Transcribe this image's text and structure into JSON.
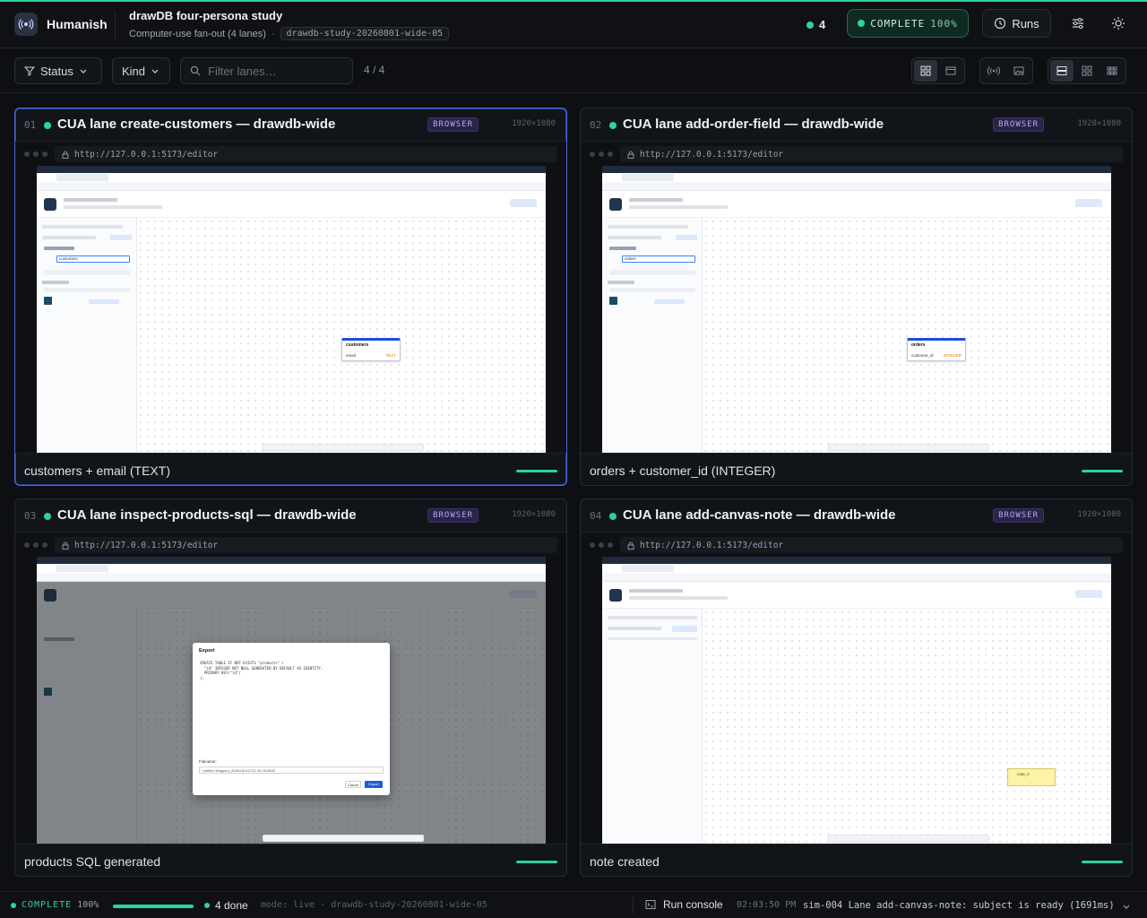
{
  "brand": {
    "name": "Humanish"
  },
  "header": {
    "title": "drawDB four-persona study",
    "subtitle": "Computer-use fan-out (4 lanes)",
    "separator": "·",
    "study_id": "drawdb-study-20260801-wide-05",
    "live_count": "4",
    "status_label": "COMPLETE",
    "status_pct": "100%",
    "runs_label": "Runs"
  },
  "toolbar": {
    "status_label": "Status",
    "kind_label": "Kind",
    "search_placeholder": "Filter lanes…",
    "count": "4 / 4"
  },
  "lanes": [
    {
      "num": "01",
      "title": "CUA lane create-customers — drawdb-wide",
      "badge": "BROWSER",
      "res": "1920×1080",
      "url": "http://127.0.0.1:5173/editor",
      "caption": "customers + email (TEXT)",
      "table_name": "customers",
      "field": "email",
      "field_type": "TEXT",
      "input_value": "customers"
    },
    {
      "num": "02",
      "title": "CUA lane add-order-field — drawdb-wide",
      "badge": "BROWSER",
      "res": "1920×1080",
      "url": "http://127.0.0.1:5173/editor",
      "caption": "orders + customer_id (INTEGER)",
      "table_name": "orders",
      "field": "customer_id",
      "field_type": "INTEGER",
      "input_value": "orders"
    },
    {
      "num": "03",
      "title": "CUA lane inspect-products-sql — drawdb-wide",
      "badge": "BROWSER",
      "res": "1920×1080",
      "url": "http://127.0.0.1:5173/editor",
      "caption": "products SQL generated",
      "modal_title": "Export",
      "sql": "CREATE TABLE IF NOT EXISTS \"products\" (\n  \"id\" INTEGER NOT NULL GENERATED BY DEFAULT AS IDENTITY,\n  PRIMARY KEY(\"id\")\n);",
      "filename_label": "Filename:",
      "filename": "Untitled Diagram_2026-08-01T21-03-16.964Z",
      "cancel": "Cancel",
      "export": "Export"
    },
    {
      "num": "04",
      "title": "CUA lane add-canvas-note — drawdb-wide",
      "badge": "BROWSER",
      "res": "1920×1080",
      "url": "http://127.0.0.1:5173/editor",
      "caption": "note created",
      "note_label": "note_0"
    }
  ],
  "statusbar": {
    "status": "COMPLETE",
    "pct": "100%",
    "done": "4 done",
    "mode": "mode: live · drawdb-study-20260801-wide-05",
    "console_label": "Run console",
    "time": "02:03:50 PM",
    "message": "sim-004 Lane add-canvas-note: subject is ready (1691ms)"
  },
  "colors": {
    "accent": "#2fd39a",
    "selected_border": "#4a6bd8",
    "badge": "#b6a8ef"
  },
  "icons": [
    "broadcast-icon",
    "clock-icon",
    "sliders-icon",
    "sun-icon",
    "filter-icon",
    "chevron-down-icon",
    "search-icon",
    "grid-icon",
    "window-icon",
    "signal-icon",
    "image-icon",
    "rows-icon",
    "grid-small-icon",
    "grid-dense-icon",
    "lock-icon",
    "console-icon"
  ]
}
